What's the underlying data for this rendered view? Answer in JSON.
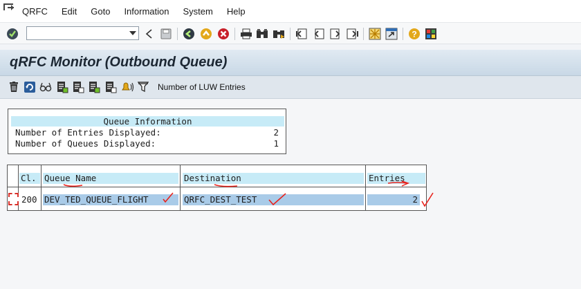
{
  "menu": {
    "items": [
      {
        "label": "QRFC",
        "name": "menu-qrfc"
      },
      {
        "label": "Edit",
        "name": "menu-edit"
      },
      {
        "label": "Goto",
        "name": "menu-goto"
      },
      {
        "label": "Information",
        "name": "menu-information"
      },
      {
        "label": "System",
        "name": "menu-system"
      },
      {
        "label": "Help",
        "name": "menu-help"
      }
    ]
  },
  "toolbar": {
    "command_value": "",
    "icons": [
      "enter-icon",
      "back-icon",
      "save-icon",
      "exit-icon",
      "cancel-icon",
      "print-icon",
      "find-icon",
      "find-next-icon",
      "first-page-icon",
      "previous-page-icon",
      "next-page-icon",
      "last-page-icon",
      "create-session-icon",
      "shortcut-icon",
      "help-icon",
      "customize-layout-icon"
    ]
  },
  "title": "qRFC Monitor (Outbound Queue)",
  "app_toolbar": {
    "icons": [
      "delete-icon",
      "refresh-icon",
      "glasses-icon",
      "document-icon",
      "document-2-icon",
      "document-3-icon",
      "document-4-icon",
      "bell-icon",
      "filter-icon"
    ],
    "label": "Number of LUW Entries"
  },
  "queue_info": {
    "header": "Queue Information",
    "rows": [
      {
        "label": "Number of Entries Displayed:",
        "value": "2"
      },
      {
        "label": "Number of Queues Displayed:",
        "value": "1"
      }
    ]
  },
  "queue_table": {
    "columns": [
      "Cl.",
      "Queue Name",
      "Destination",
      "Entries"
    ],
    "rows": [
      {
        "client": "200",
        "queue_name": "DEV_TED_QUEUE_FLIGHT",
        "destination": "QRFC_DEST_TEST",
        "entries": "2"
      }
    ]
  },
  "colors": {
    "header_cell": "#c7ebf7",
    "selected_row": "#a9cbe8",
    "annotation_red": "#e8221c"
  }
}
